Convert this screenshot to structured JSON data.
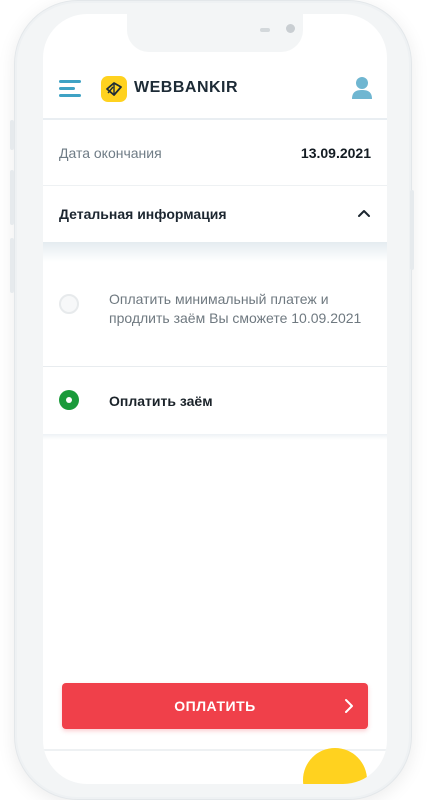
{
  "header": {
    "brand": "WEBBANKIR",
    "menu_icon": "hamburger-menu-icon",
    "user_icon": "user-profile-icon",
    "logo_icon": "webbankir-logo-icon",
    "accent": "#3fa2c4",
    "logo_color": "#ffd21f"
  },
  "details": {
    "end_date_label": "Дата окончания",
    "end_date_value": "13.09.2021",
    "detail_label": "Детальная информация",
    "detail_icon": "chevron-up-icon"
  },
  "options": [
    {
      "text": "Оплатить минимальный платеж и продлить заём Вы сможете 10.09.2021",
      "selected": false
    },
    {
      "text": "Оплатить заём",
      "selected": true
    }
  ],
  "pay_button": {
    "label": "ОПЛАТИТЬ",
    "icon": "chevron-right-icon",
    "color": "#f0404a"
  },
  "colors": {
    "radio_selected": "#1a9a3a"
  }
}
